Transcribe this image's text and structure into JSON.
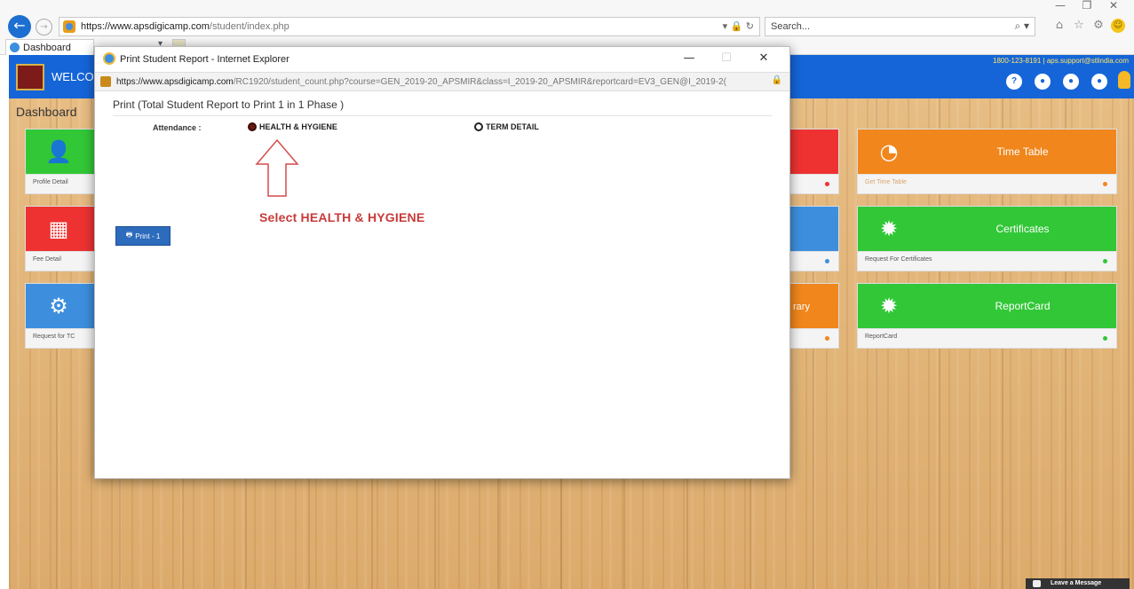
{
  "browser": {
    "url_host": "https://www.apsdigicamp.com",
    "url_path": "/student/index.php",
    "search_placeholder": "Search...",
    "tab_label": "Dashboard"
  },
  "header": {
    "welcome": "WELCO",
    "contact": "1800-123-8191 | aps.support@stlindia.com"
  },
  "dashboard": {
    "title": "Dashboard",
    "cards": [
      {
        "title": "",
        "footer": "Profile Detail",
        "color": "#32c737"
      },
      {
        "title": "",
        "footer": "Fee Detail",
        "color": "#ee3232"
      },
      {
        "title": "",
        "footer": "Request for TC",
        "color": "#3d8fde"
      },
      {
        "title": "",
        "footer": "",
        "color": "#ee3232"
      },
      {
        "title": "",
        "footer": "",
        "color": "#3d8fde"
      },
      {
        "title": "rary",
        "footer": "",
        "color": "#f0861c"
      },
      {
        "title": "Time Table",
        "footer": "Get Time Table",
        "color": "#f0861c"
      },
      {
        "title": "Certificates",
        "footer": "Request For Certificates",
        "color": "#32c737"
      },
      {
        "title": "ReportCard",
        "footer": "ReportCard",
        "color": "#32c737"
      }
    ]
  },
  "popup": {
    "window_title": "Print Student Report - Internet Explorer",
    "url_host": "https://www.apsdigicamp.com",
    "url_path": "/RC1920/student_count.php?course=GEN_2019-20_APSMIR&class=I_2019-20_APSMIR&reportcard=EV3_GEN@I_2019-2(",
    "heading": "Print (Total Student Report to Print 1 in 1 Phase )",
    "attendance_label": "Attendance :",
    "option_health": "HEALTH & HYGIENE",
    "option_term": "TERM DETAIL",
    "print_button": "Print - 1",
    "annotation": "Select HEALTH & HYGIENE"
  },
  "leave_message": "Leave a Message"
}
